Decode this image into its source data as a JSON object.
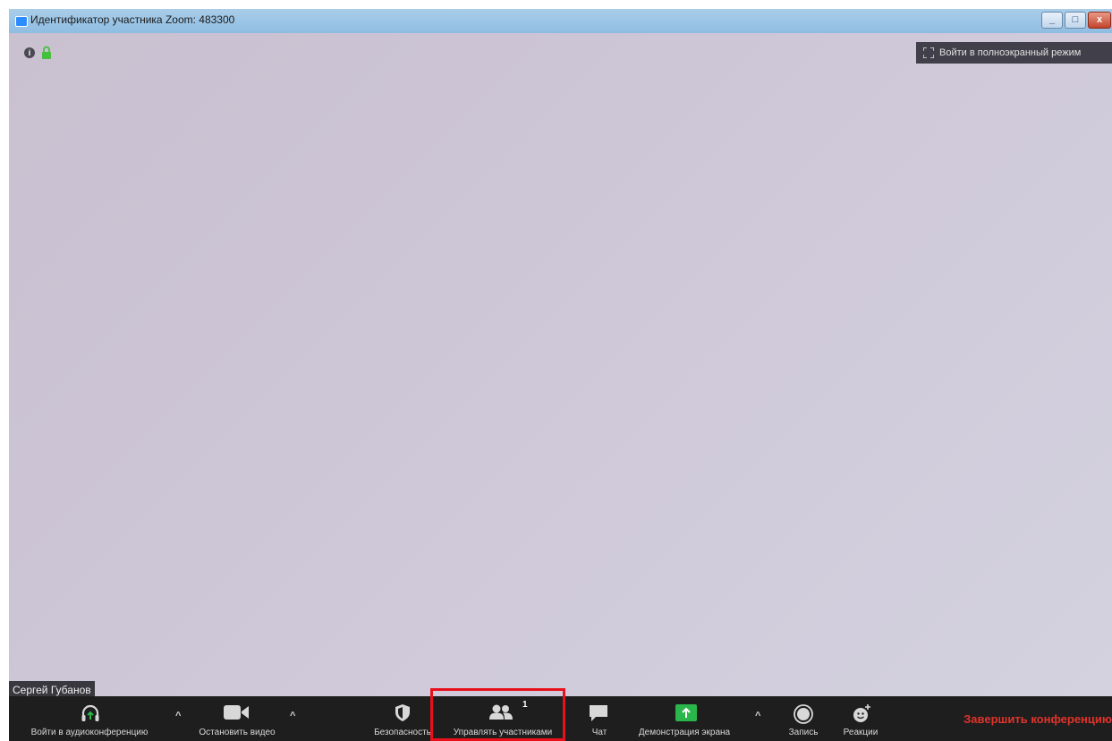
{
  "window": {
    "title": "Идентификатор участника Zoom: 483300",
    "minimize_label": "_",
    "maximize_label": "□",
    "close_label": "x"
  },
  "video": {
    "info_icon": "info-icon",
    "lock_icon": "lock-icon",
    "fullscreen_label": "Войти в полноэкранный режим",
    "participant_name": "Сергей Губанов"
  },
  "toolbar": {
    "audio_label": "Войти в аудиоконференцию",
    "video_label": "Остановить видео",
    "security_label": "Безопасность",
    "participants_label": "Управлять участниками",
    "participants_count": "1",
    "chat_label": "Чат",
    "share_label": "Демонстрация экрана",
    "record_label": "Запись",
    "reactions_label": "Реакции",
    "end_label": "Завершить конференцию",
    "caret": "^"
  },
  "colors": {
    "toolbar_bg": "#1e1e1e",
    "share_green": "#2ab64a",
    "end_red": "#e0342c",
    "highlight_red": "#e8111b"
  }
}
